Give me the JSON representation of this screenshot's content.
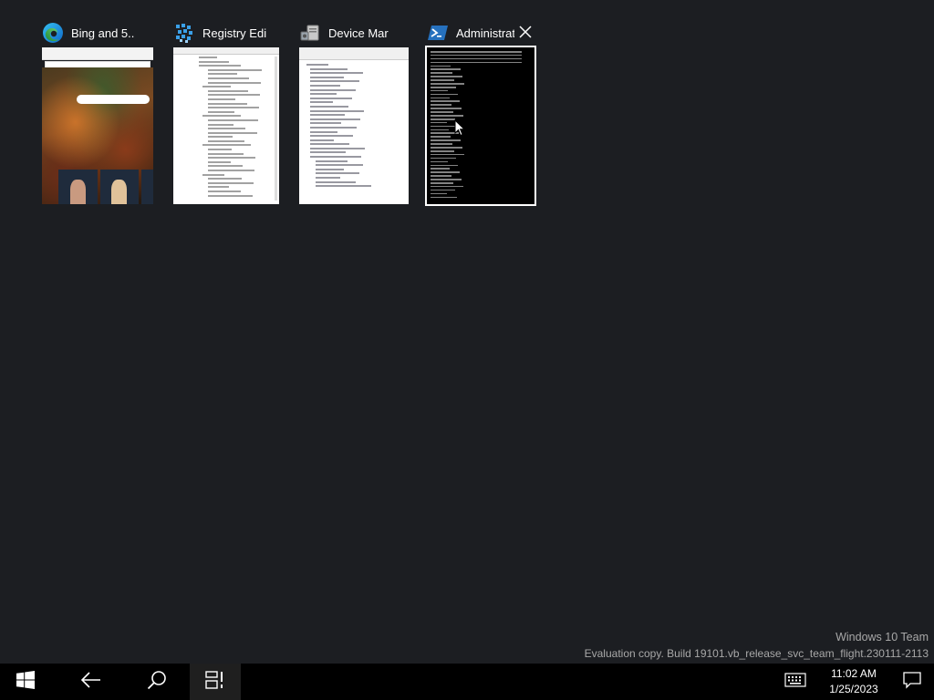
{
  "task_view": {
    "windows": [
      {
        "title": "Bing and 5..",
        "app": "Microsoft Edge",
        "icon": "edge-icon",
        "selected": false
      },
      {
        "title": "Registry Edi",
        "app": "Registry Editor",
        "icon": "registry-editor-icon",
        "selected": false
      },
      {
        "title": "Device Mar",
        "app": "Device Manager",
        "icon": "device-manager-icon",
        "selected": false
      },
      {
        "title": "Administrat",
        "app": "Windows PowerShell",
        "icon": "powershell-icon",
        "selected": true
      }
    ]
  },
  "watermark": {
    "title": "Windows 10 Team",
    "build": "Evaluation copy. Build 19101.vb_release_svc_team_flight.230111-2113"
  },
  "taskbar": {
    "time": "11:02 AM",
    "date": "1/25/2023",
    "icons": [
      "windows-start-icon",
      "back-arrow-icon",
      "search-icon",
      "task-view-icon",
      "touch-keyboard-icon",
      "action-center-icon"
    ]
  },
  "colors": {
    "background": "#1c1e22",
    "taskbar": "#000000",
    "watermark_text": "#a8a8a8"
  }
}
